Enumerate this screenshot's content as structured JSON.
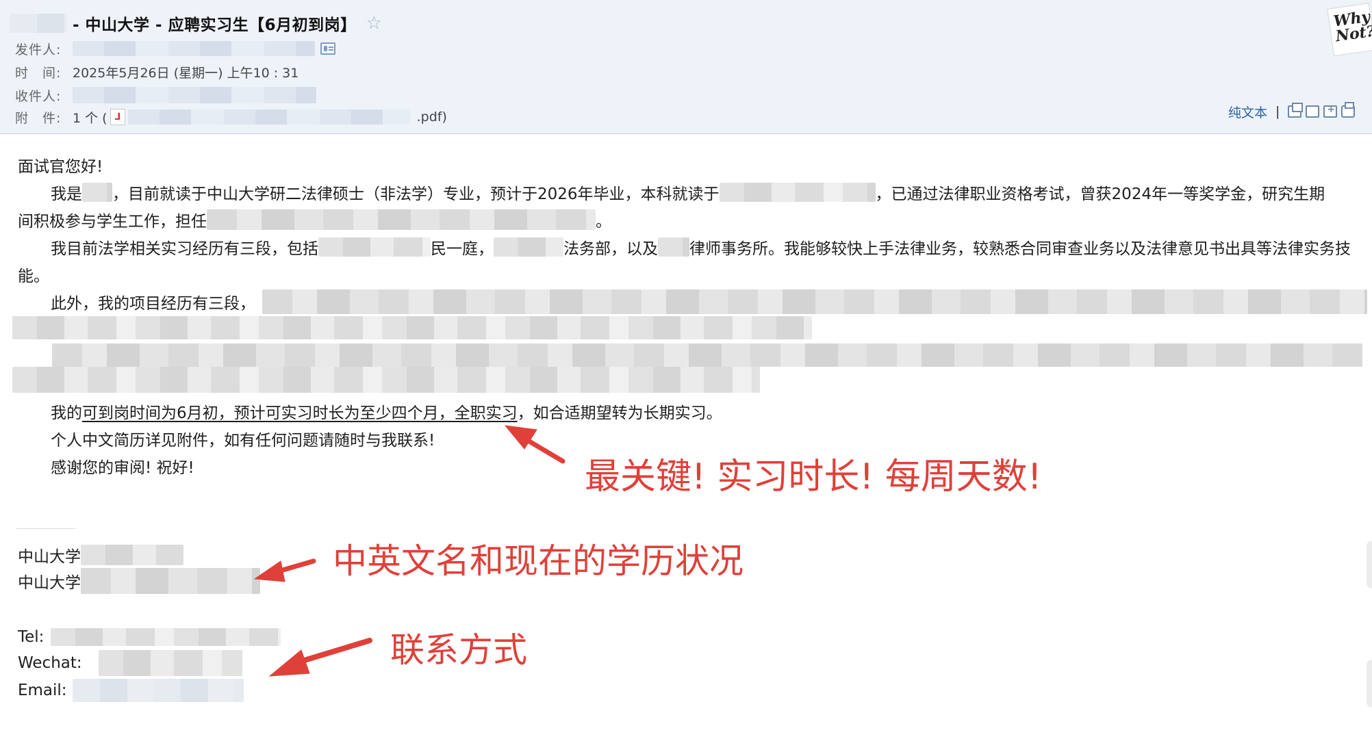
{
  "email": {
    "subject": "- 中山大学 - 应聘实习生【6月初到岗】",
    "star_icon": "☆",
    "meta": {
      "sender_label": "发件人:",
      "time_label": "时　间:",
      "time_value": "2025年5月26日 (星期一) 上午10 : 31",
      "recipient_label": "收件人:",
      "attachment_label": "附　件:",
      "attachment_count": "1 个 (",
      "attachment_ext": ".pdf)"
    },
    "toolbar": {
      "plain_text": "纯文本",
      "separator": "|"
    }
  },
  "body": {
    "greeting": "面试官您好!",
    "p1_a": "我是",
    "p1_b": "，目前就读于中山大学研二法律硕士（非法学）专业，预计于2026年毕业，本科就读于",
    "p1_c": "，已通过法律职业资格考试，曾获2024年一等奖学金，研究生期",
    "p1_d": "间积极参与学生工作，担任",
    "p1_e": "。",
    "p2_a": "我目前法学相关实习经历有三段，包括",
    "p2_b": "民一庭，",
    "p2_c": "法务部，以及",
    "p2_d": "律师事务所。我能够较快上手法律业务，较熟悉合同审查业务以及法律意见书出具等法律实务技",
    "p2_e": "能。",
    "p3_a": "此外，我的项目经历有三段，",
    "p4_a": "我的",
    "p4_u": "可到岗时间为6月初，预计可实习时长为至少四个月，全职实习",
    "p4_b": "，如合适期望转为长期实习。",
    "p5": "个人中文简历详见附件，如有任何问题请随时与我联系!",
    "p6": "感谢您的审阅! 祝好!"
  },
  "signature": {
    "line1": "中山大学",
    "line2": "中山大学",
    "tel": "Tel:",
    "wechat": "Wechat:",
    "email": "Email:"
  },
  "annotations": {
    "a1": "最关键! 实习时长! 每周天数!",
    "a2": "中英文名和现在的学历状况",
    "a3": "联系方式",
    "color": "#e0403a"
  }
}
